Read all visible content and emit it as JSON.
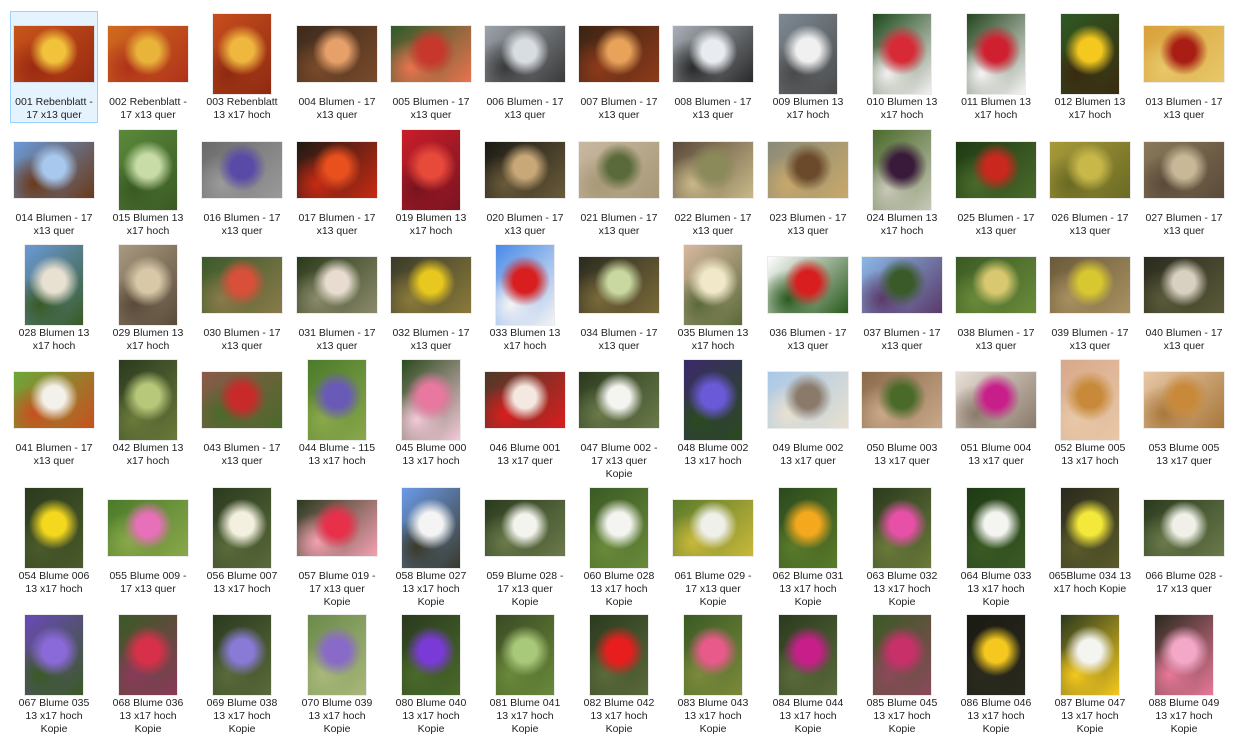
{
  "window": {
    "view": "large-icons"
  },
  "files": [
    {
      "name": "001 Rebenblatt - 17 x13 quer",
      "orient": "landscape",
      "colors": [
        "#c9551a",
        "#f2c23b",
        "#9a2a12"
      ]
    },
    {
      "name": "002 Rebenblatt - 17 x13 quer",
      "orient": "landscape",
      "colors": [
        "#d06b1e",
        "#e8b43a",
        "#b0321a"
      ]
    },
    {
      "name": "003 Rebenblatt 13 x17 hoch",
      "orient": "portrait",
      "colors": [
        "#c84e1c",
        "#f0b73e",
        "#8e2a12"
      ]
    },
    {
      "name": "004 Blumen - 17 x13 quer",
      "orient": "landscape",
      "colors": [
        "#3b2a1c",
        "#e6a06a",
        "#7a4a2a"
      ]
    },
    {
      "name": "005 Blumen - 17 x13 quer",
      "orient": "landscape",
      "colors": [
        "#2e5a2a",
        "#c8372b",
        "#e8734f"
      ]
    },
    {
      "name": "006 Blumen - 17 x13 quer",
      "orient": "landscape",
      "colors": [
        "#9ca3aa",
        "#d8dde2",
        "#3a3a3a"
      ]
    },
    {
      "name": "007 Blumen - 17 x13 quer",
      "orient": "landscape",
      "colors": [
        "#3a2414",
        "#e8a25a",
        "#8e3a1a"
      ]
    },
    {
      "name": "008 Blumen - 17 x13 quer",
      "orient": "landscape",
      "colors": [
        "#a9b0b8",
        "#e8ecf0",
        "#2a2a2a"
      ]
    },
    {
      "name": "009 Blumen 13 x17 hoch",
      "orient": "portrait",
      "colors": [
        "#7e8a94",
        "#f0f0f0",
        "#4a4a4a"
      ]
    },
    {
      "name": "010 Blumen 13 x17 hoch",
      "orient": "portrait",
      "colors": [
        "#1e4a1c",
        "#d82a36",
        "#f4f0f0"
      ]
    },
    {
      "name": "011 Blumen 13 x17 hoch",
      "orient": "portrait",
      "colors": [
        "#24461e",
        "#d02030",
        "#f6f4f4"
      ]
    },
    {
      "name": "012 Blumen 13 x17 hoch",
      "orient": "portrait",
      "colors": [
        "#2e5a24",
        "#f4c81e",
        "#3a2a10"
      ]
    },
    {
      "name": "013 Blumen - 17 x13 quer",
      "orient": "landscape",
      "colors": [
        "#d8a03a",
        "#a81e14",
        "#e8c86a"
      ]
    },
    {
      "name": "014 Blumen - 17 x13 quer",
      "orient": "landscape",
      "colors": [
        "#6a9ad8",
        "#a8c8ee",
        "#6a3a1a"
      ]
    },
    {
      "name": "015 Blumen 13 x17 hoch",
      "orient": "portrait",
      "colors": [
        "#5a8a3a",
        "#c8dca8",
        "#3a5a24"
      ]
    },
    {
      "name": "016 Blumen - 17 x13 quer",
      "orient": "landscape",
      "colors": [
        "#6a6a6a",
        "#5a4aa8",
        "#9a9a9a"
      ]
    },
    {
      "name": "017 Blumen - 17 x13 quer",
      "orient": "landscape",
      "colors": [
        "#1e1a14",
        "#e8501e",
        "#c82a14"
      ]
    },
    {
      "name": "019 Blumen 13 x17 hoch",
      "orient": "portrait",
      "colors": [
        "#c81e2a",
        "#e84a3a",
        "#7a1420"
      ]
    },
    {
      "name": "020 Blumen - 17 x13 quer",
      "orient": "landscape",
      "colors": [
        "#1a1a14",
        "#c8a878",
        "#6a5a3a"
      ]
    },
    {
      "name": "021 Blumen - 17 x13 quer",
      "orient": "landscape",
      "colors": [
        "#c8b8a0",
        "#5a6a3a",
        "#a89878"
      ]
    },
    {
      "name": "022 Blumen - 17 x13 quer",
      "orient": "landscape",
      "colors": [
        "#5a4a3a",
        "#8a8a5a",
        "#c8b888"
      ]
    },
    {
      "name": "023 Blumen - 17 x13 quer",
      "orient": "landscape",
      "colors": [
        "#8a8a7a",
        "#6a4a2a",
        "#c8a86a"
      ]
    },
    {
      "name": "024 Blumen 13 x17 hoch",
      "orient": "portrait",
      "colors": [
        "#4a6a2a",
        "#3a1a3a",
        "#c8c8b8"
      ]
    },
    {
      "name": "025 Blumen - 17 x13 quer",
      "orient": "landscape",
      "colors": [
        "#1e3a14",
        "#c8281e",
        "#4a6a2a"
      ]
    },
    {
      "name": "026 Blumen - 17 x13 quer",
      "orient": "landscape",
      "colors": [
        "#a89a3a",
        "#c8b84a",
        "#6a6a24"
      ]
    },
    {
      "name": "027 Blumen - 17 x13 quer",
      "orient": "landscape",
      "colors": [
        "#8a7a5a",
        "#c8b898",
        "#5a4a3a"
      ]
    },
    {
      "name": "028 Blumen 13 x17 hoch",
      "orient": "portrait",
      "colors": [
        "#6a9ad8",
        "#e8e0d0",
        "#3a5a24"
      ]
    },
    {
      "name": "029 Blumen 13 x17 hoch",
      "orient": "portrait",
      "colors": [
        "#a89a80",
        "#d8c8a8",
        "#5a4a3a"
      ]
    },
    {
      "name": "030 Blumen - 17 x13 quer",
      "orient": "landscape",
      "colors": [
        "#3a5a2a",
        "#d8503a",
        "#8a7a4a"
      ]
    },
    {
      "name": "031 Blumen - 17 x13 quer",
      "orient": "landscape",
      "colors": [
        "#2a3a1a",
        "#e8dcd0",
        "#8a8a6a"
      ]
    },
    {
      "name": "032 Blumen - 17 x13 quer",
      "orient": "landscape",
      "colors": [
        "#3a3a2a",
        "#e8c81e",
        "#8a7a3a"
      ]
    },
    {
      "name": "033 Blumen 13 x17 hoch",
      "orient": "portrait",
      "colors": [
        "#4a8ae8",
        "#d81e1e",
        "#f4f4f4"
      ]
    },
    {
      "name": "034 Blumen - 17 x13 quer",
      "orient": "landscape",
      "colors": [
        "#2a2a1e",
        "#c8d8a0",
        "#7a6a3a"
      ]
    },
    {
      "name": "035 Blumen 13 x17 hoch",
      "orient": "portrait",
      "colors": [
        "#d8b8a0",
        "#f0e8c8",
        "#5a6a3a"
      ]
    },
    {
      "name": "036 Blumen - 17 x13 quer",
      "orient": "landscape",
      "colors": [
        "#ffffff",
        "#d81e1e",
        "#2a5a1e"
      ]
    },
    {
      "name": "037 Blumen - 17 x13 quer",
      "orient": "landscape",
      "colors": [
        "#8ab8e8",
        "#3a5a2a",
        "#5a3a6a"
      ]
    },
    {
      "name": "038 Blumen - 17 x13 quer",
      "orient": "landscape",
      "colors": [
        "#3a5a24",
        "#d8c870",
        "#6a8a3a"
      ]
    },
    {
      "name": "039 Blumen - 17 x13 quer",
      "orient": "landscape",
      "colors": [
        "#6a5a3a",
        "#d8c830",
        "#a89060"
      ]
    },
    {
      "name": "040 Blumen - 17 x13 quer",
      "orient": "landscape",
      "colors": [
        "#2a2a1e",
        "#d8d0c0",
        "#5a5a3a"
      ]
    },
    {
      "name": "041 Blumen - 17 x13 quer",
      "orient": "landscape",
      "colors": [
        "#6aa83a",
        "#f4f0ea",
        "#c8501e"
      ]
    },
    {
      "name": "042 Blumen 13 x17 hoch",
      "orient": "portrait",
      "colors": [
        "#2a3a1e",
        "#b8c87a",
        "#6a7a3a"
      ]
    },
    {
      "name": "043 Blumen - 17 x13 quer",
      "orient": "landscape",
      "colors": [
        "#8a5a4a",
        "#c82a2a",
        "#4a6a2a"
      ]
    },
    {
      "name": "044 Blume - 115 13 x17 hoch",
      "orient": "portrait",
      "colors": [
        "#4a7a2a",
        "#6a5ab8",
        "#8aa84a"
      ]
    },
    {
      "name": "045 Blume 000 13 x17 hoch",
      "orient": "portrait",
      "colors": [
        "#2a4a1e",
        "#e878a0",
        "#f4c8d8"
      ]
    },
    {
      "name": "046 Blume 001 13 x17 quer",
      "orient": "landscape",
      "colors": [
        "#4a3a2a",
        "#f4e8e0",
        "#d81e1e"
      ]
    },
    {
      "name": "047 Blume 002 - 17 x13 quer Kopie",
      "orient": "landscape",
      "colors": [
        "#2a3a1e",
        "#f4f4f0",
        "#6a7a4a"
      ]
    },
    {
      "name": "048 Blume 002 13 x17 hoch",
      "orient": "portrait",
      "colors": [
        "#3a2a6a",
        "#6a5ad8",
        "#2a4a1e"
      ]
    },
    {
      "name": "049 Blume 002 13 x17 quer",
      "orient": "landscape",
      "colors": [
        "#a8c8e8",
        "#8a7a6a",
        "#e8e0d0"
      ]
    },
    {
      "name": "050 Blume 003 13 x17 quer",
      "orient": "landscape",
      "colors": [
        "#8a6a4a",
        "#4a6a2a",
        "#c8a888"
      ]
    },
    {
      "name": "051 Blume 004 13 x17 quer",
      "orient": "landscape",
      "colors": [
        "#e8e0d8",
        "#c81e8a",
        "#8a7a6a"
      ]
    },
    {
      "name": "052 Blume 005 13 x17 hoch",
      "orient": "portrait",
      "colors": [
        "#d8a88a",
        "#c88a3a",
        "#e8c8a8"
      ]
    },
    {
      "name": "053 Blume 005 13 x17 quer",
      "orient": "landscape",
      "colors": [
        "#e8c8a8",
        "#c88a3a",
        "#a8783a"
      ]
    },
    {
      "name": "054 Blume 006 13 x17 hoch",
      "orient": "portrait",
      "colors": [
        "#2a3a1e",
        "#f4d81e",
        "#4a5a2a"
      ]
    },
    {
      "name": "055 Blume 009 - 17 x13 quer",
      "orient": "landscape",
      "colors": [
        "#4a7a2a",
        "#e870b8",
        "#8aa84a"
      ]
    },
    {
      "name": "056 Blume 007 13 x17 hoch",
      "orient": "portrait",
      "colors": [
        "#2a3a1e",
        "#f4f0e0",
        "#5a6a3a"
      ]
    },
    {
      "name": "057 Blume 019 - 17 x13 quer Kopie",
      "orient": "landscape",
      "colors": [
        "#2a3a1e",
        "#e8304a",
        "#f4a0b0"
      ]
    },
    {
      "name": "058 Blume 027 13 x17 hoch Kopie",
      "orient": "portrait",
      "colors": [
        "#6a9ae8",
        "#f4f4f4",
        "#3a3a2a"
      ]
    },
    {
      "name": "059 Blume 028 - 17 x13 quer Kopie",
      "orient": "landscape",
      "colors": [
        "#2a3a1e",
        "#f4f4ee",
        "#6a7a4a"
      ]
    },
    {
      "name": "060 Blume 028 13 x17 hoch Kopie",
      "orient": "portrait",
      "colors": [
        "#3a5a24",
        "#f4f4f0",
        "#6a8a3a"
      ]
    },
    {
      "name": "061 Blume 029 - 17 x13 quer Kopie",
      "orient": "landscape",
      "colors": [
        "#5a7a2a",
        "#f0f0ea",
        "#c8b83a"
      ]
    },
    {
      "name": "062 Blume 031 13 x17 hoch Kopie",
      "orient": "portrait",
      "colors": [
        "#2a4a1e",
        "#f4a81e",
        "#5a7a2a"
      ]
    },
    {
      "name": "063 Blume 032 13 x17 hoch Kopie",
      "orient": "portrait",
      "colors": [
        "#2a3a1e",
        "#e850a8",
        "#6a7a3a"
      ]
    },
    {
      "name": "064 Blume 033 13 x17 hoch Kopie",
      "orient": "portrait",
      "colors": [
        "#1e3a14",
        "#f4f4f0",
        "#3a5a24"
      ]
    },
    {
      "name": "065Blume 034 13 x17 hoch Kopie",
      "orient": "portrait",
      "colors": [
        "#2a2a1e",
        "#f4e83a",
        "#5a5a2a"
      ]
    },
    {
      "name": "066 Blume 028 - 17 x13 quer",
      "orient": "landscape",
      "colors": [
        "#2a3a1e",
        "#f0f0e8",
        "#6a7a4a"
      ]
    },
    {
      "name": "067 Blume 035 13 x17 hoch Kopie",
      "orient": "portrait",
      "colors": [
        "#6a4ab8",
        "#8a6ad8",
        "#3a5a24"
      ]
    },
    {
      "name": "068 Blume 036 13 x17 hoch Kopie",
      "orient": "portrait",
      "colors": [
        "#3a5a24",
        "#d8304a",
        "#8a3a5a"
      ]
    },
    {
      "name": "069 Blume 038 13 x17 hoch Kopie",
      "orient": "portrait",
      "colors": [
        "#2a3a1e",
        "#8a7ad8",
        "#5a6a3a"
      ]
    },
    {
      "name": "070 Blume 039 13 x17 hoch Kopie",
      "orient": "portrait",
      "colors": [
        "#6a8a4a",
        "#8a6ac8",
        "#a8b87a"
      ]
    },
    {
      "name": "080 Blume 040 13 x17 hoch Kopie",
      "orient": "portrait",
      "colors": [
        "#2a3a1e",
        "#7a3ad8",
        "#4a6a2a"
      ]
    },
    {
      "name": "081 Blume 041 13 x17 hoch Kopie",
      "orient": "portrait",
      "colors": [
        "#3a4a24",
        "#a8c87a",
        "#6a8a3a"
      ]
    },
    {
      "name": "082 Blume 042 13 x17 hoch Kopie",
      "orient": "portrait",
      "colors": [
        "#2a3a1e",
        "#e81e1e",
        "#5a6a3a"
      ]
    },
    {
      "name": "083 Blume 043 13 x17 hoch Kopie",
      "orient": "portrait",
      "colors": [
        "#3a5a24",
        "#e85a8a",
        "#7a8a3a"
      ]
    },
    {
      "name": "084 Blume 044 13 x17 hoch Kopie",
      "orient": "portrait",
      "colors": [
        "#2a3a1e",
        "#c81e8a",
        "#5a6a3a"
      ]
    },
    {
      "name": "085 Blume 045 13 x17 hoch Kopie",
      "orient": "portrait",
      "colors": [
        "#3a5a24",
        "#c8306a",
        "#8a4a5a"
      ]
    },
    {
      "name": "086 Blume 046 13 x17 hoch Kopie",
      "orient": "portrait",
      "colors": [
        "#1a1a14",
        "#f4c81e",
        "#2a2a1e"
      ]
    },
    {
      "name": "087 Blume 047 13 x17 hoch Kopie",
      "orient": "portrait",
      "colors": [
        "#2a3a1e",
        "#f4f4f0",
        "#f4c81e"
      ]
    },
    {
      "name": "088 Blume 049 13 x17 hoch Kopie",
      "orient": "portrait",
      "colors": [
        "#2a2a1e",
        "#f4a8c8",
        "#e87898"
      ]
    }
  ]
}
